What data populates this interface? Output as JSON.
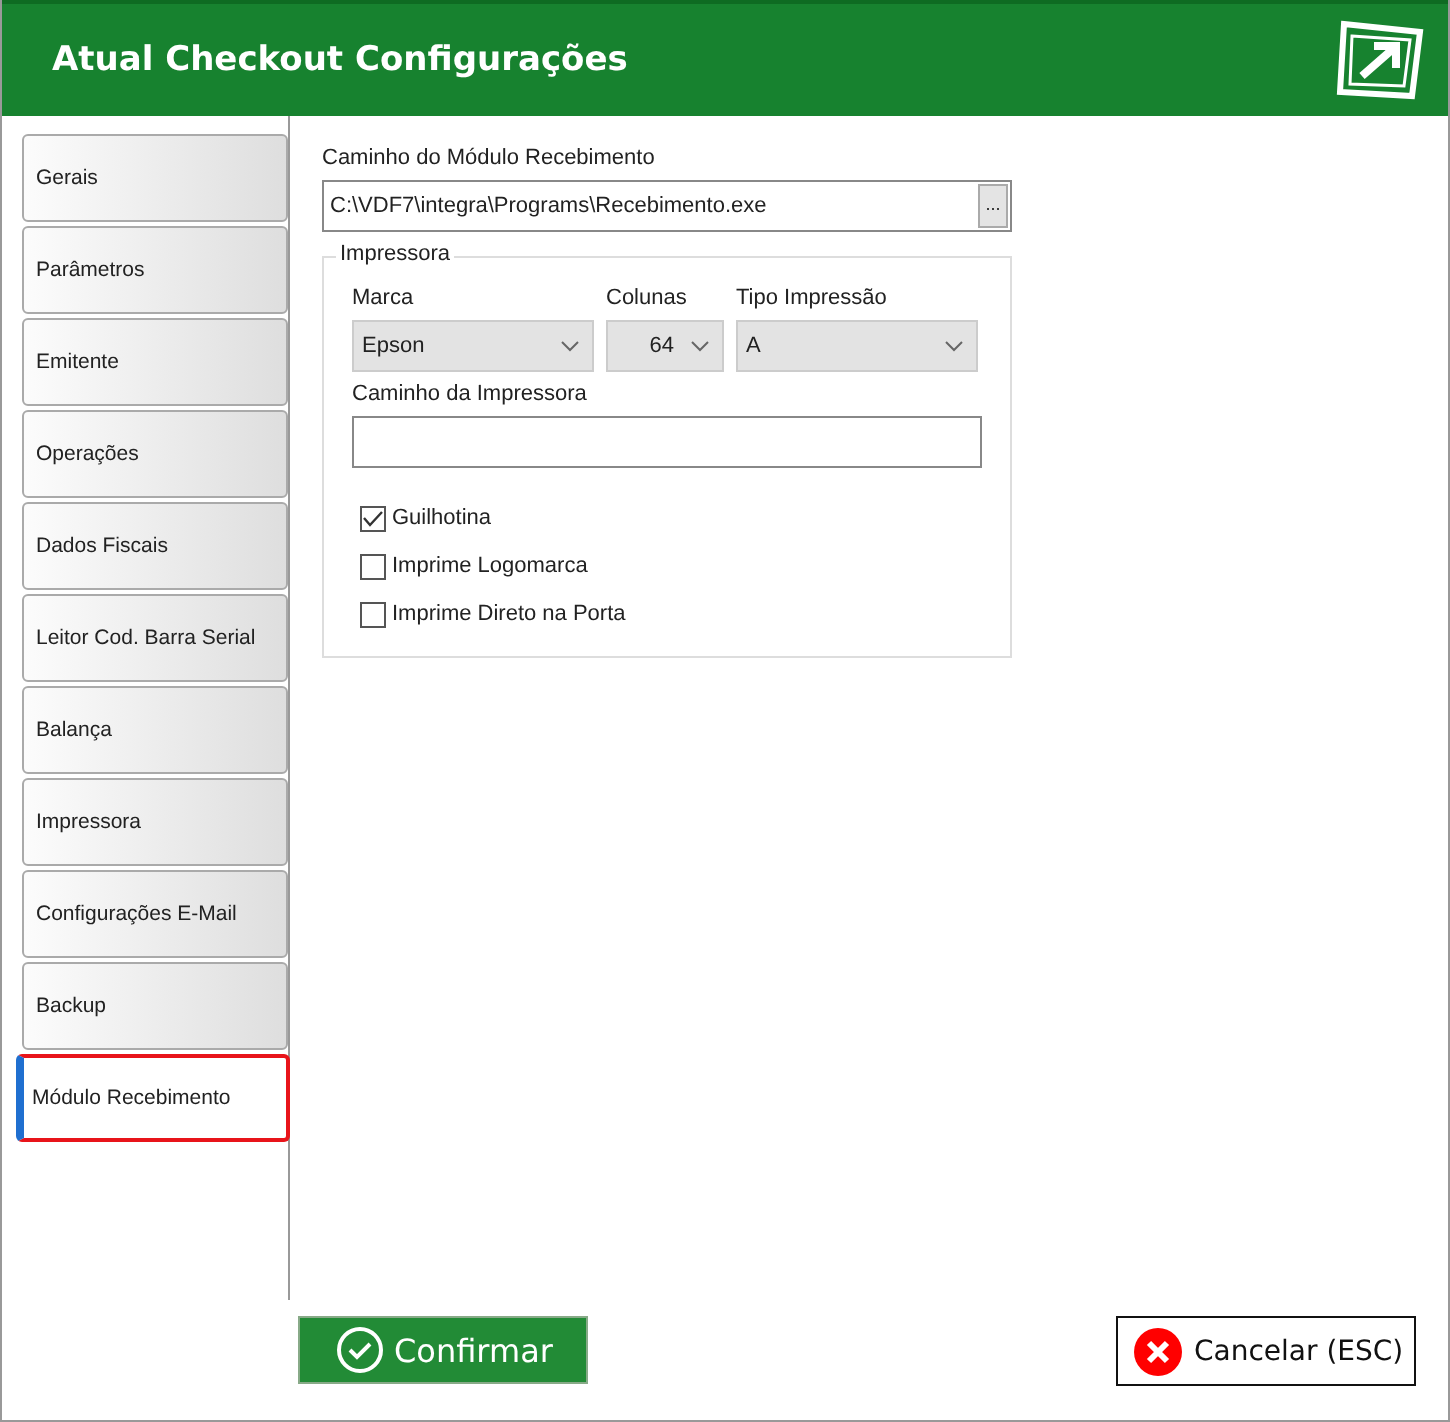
{
  "window": {
    "title": "Atual Checkout Configurações"
  },
  "tabs": [
    {
      "label": "Gerais",
      "selected": false
    },
    {
      "label": "Parâmetros",
      "selected": false
    },
    {
      "label": "Emitente",
      "selected": false
    },
    {
      "label": "Operações",
      "selected": false
    },
    {
      "label": "Dados Fiscais",
      "selected": false
    },
    {
      "label": "Leitor Cod. Barra Serial",
      "selected": false
    },
    {
      "label": "Balança",
      "selected": false
    },
    {
      "label": "Impressora",
      "selected": false
    },
    {
      "label": "Configurações E-Mail",
      "selected": false
    },
    {
      "label": "Backup",
      "selected": false
    },
    {
      "label": "Módulo Recebimento",
      "selected": true
    }
  ],
  "module_path": {
    "label": "Caminho do Módulo Recebimento",
    "value": "C:\\VDF7\\integra\\Programs\\Recebimento.exe",
    "browse": "..."
  },
  "printer": {
    "legend": "Impressora",
    "brand": {
      "label": "Marca",
      "value": "Epson"
    },
    "columns": {
      "label": "Colunas",
      "value": "64"
    },
    "print_type": {
      "label": "Tipo Impressão",
      "value": "A"
    },
    "path": {
      "label": "Caminho da Impressora"
    },
    "options": [
      {
        "label": "Guilhotina",
        "checked": true
      },
      {
        "label": "Imprime Logomarca",
        "checked": false
      },
      {
        "label": "Imprime Direto na Porta",
        "checked": false
      }
    ]
  },
  "buttons": {
    "confirm": "Confirmar",
    "cancel": "Cancelar (ESC)"
  }
}
